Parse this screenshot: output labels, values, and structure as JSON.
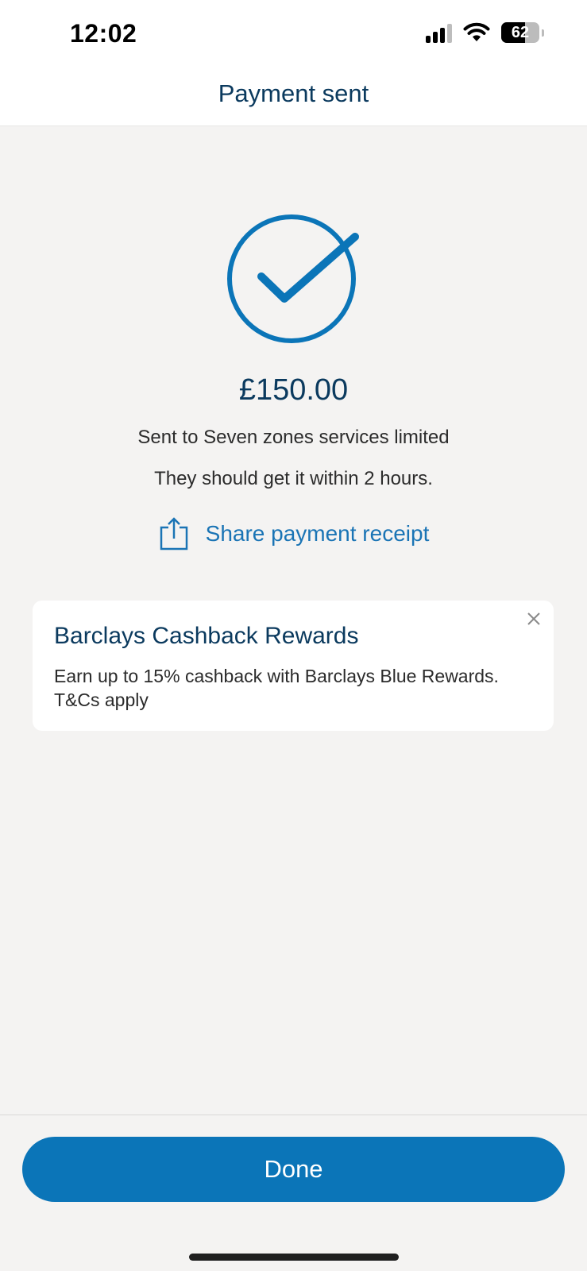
{
  "status_bar": {
    "time": "12:02",
    "battery": "62",
    "icons": [
      "signal-icon",
      "wifi-icon",
      "battery-icon"
    ]
  },
  "header": {
    "title": "Payment sent"
  },
  "confirmation": {
    "icon": "checkmark-circle-icon",
    "amount": "£150.00",
    "recipient": "Sent to Seven zones services limited",
    "eta": "They should get it within 2 hours."
  },
  "share": {
    "icon": "share-icon",
    "label": "Share payment receipt"
  },
  "promo_card": {
    "title": "Barclays Cashback Rewards",
    "text": "Earn up to 15% cashback with Barclays Blue Rewards. T&Cs apply",
    "close_icon": "close-icon"
  },
  "footer": {
    "done_label": "Done"
  },
  "colors": {
    "accent": "#0b75b8",
    "link": "#1a74b5",
    "navy_text": "#0b3a5e",
    "background": "#f4f3f2"
  }
}
